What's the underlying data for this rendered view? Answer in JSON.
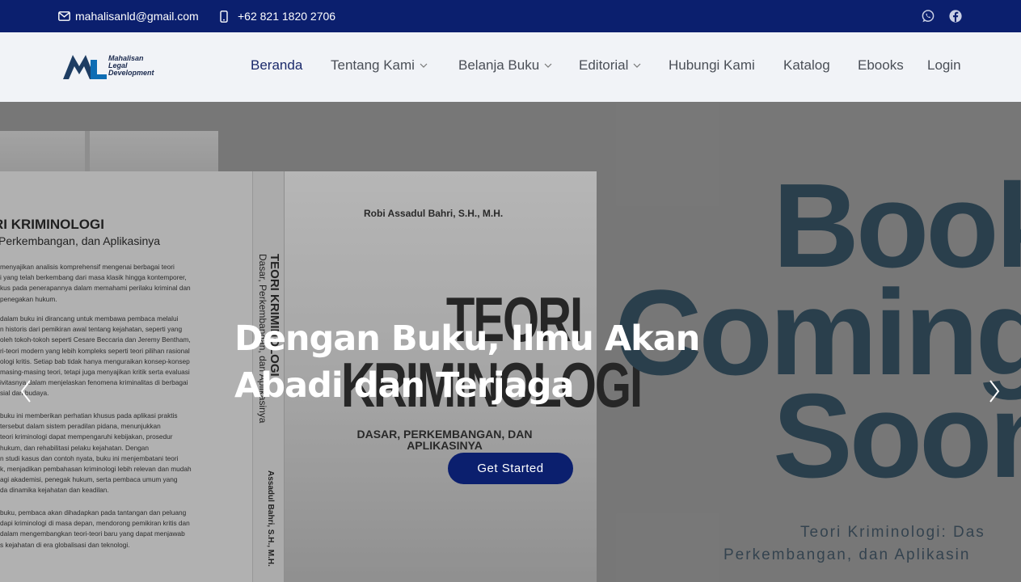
{
  "topbar": {
    "email": "mahalisanld@gmail.com",
    "phone": "+62 821 1820 2706",
    "icons": {
      "email": "envelope-icon",
      "phone": "phone-icon",
      "whatsapp": "whatsapp-icon",
      "facebook": "facebook-icon"
    }
  },
  "header": {
    "logo": {
      "line1": "Mahalisan",
      "line2": "Legal",
      "line3": "Development"
    },
    "nav": [
      {
        "label": "Beranda",
        "active": true
      },
      {
        "label": "Tentang Kami",
        "dropdown": true
      },
      {
        "label": "Belanja Buku",
        "dropdown": true
      },
      {
        "label": "Editorial",
        "dropdown": true
      },
      {
        "label": "Hubungi Kami"
      },
      {
        "label": "Katalog"
      },
      {
        "label": "Ebooks"
      },
      {
        "label": "Login"
      }
    ]
  },
  "hero": {
    "heading_line1": "Dengan Buku, Ilmu Akan",
    "heading_line2": "Abadi dan Terjaga",
    "cta_label": "Get Started",
    "book": {
      "author": "Robi Assadul Bahri, S.H., M.H.",
      "title_line1": "TEORI",
      "title_line2": "KRIMINOLOGI",
      "subtitle_line1": "DASAR, PERKEMBANGAN, DAN",
      "subtitle_line2": "APLIKASINYA",
      "back_title": "RI KRIMINOLOGI",
      "back_subtitle": "Perkembangan, dan Aplikasinya",
      "back_paragraphs": [
        [
          "menyajikan analisis komprehensif mengenai berbagai teori",
          "i yang telah berkembang dari masa klasik hingga kontemporer,",
          "kus pada penerapannya dalam memahami perilaku kriminal dan",
          "penegakan hukum."
        ],
        [
          "dalam buku ini dirancang untuk membawa pembaca melalui",
          "n historis dari pemikiran awal tentang kejahatan, seperti yang",
          "oleh tokoh-tokoh seperti Cesare Beccaria dan Jeremy Bentham,",
          "ri-teori modern yang lebih kompleks seperti teori pilihan rasional",
          "ologi kritis. Setiap bab tidak hanya menguraikan konsep-konsep",
          "masing-masing teori, tetapi juga menyajikan kritik serta evaluasi",
          "ivitasnya dalam menjelaskan fenomena kriminalitas di berbagai",
          "sial dan budaya."
        ],
        [
          "buku ini memberikan perhatian khusus pada aplikasi praktis",
          "tersebut dalam sistem peradilan pidana, menunjukkan",
          "teori kriminologi dapat mempengaruhi kebijakan, prosedur",
          "hukum, dan rehabilitasi pelaku kejahatan. Dengan",
          "n studi kasus dan contoh nyata, buku ini menjembatani teori",
          "k, menjadikan pembahasan kriminologi lebih relevan dan mudah",
          "agi akademisi, penegak hukum, serta pembaca umum yang",
          "da dinamika kejahatan dan keadilan."
        ],
        [
          "buku, pembaca akan dihadapkan pada tantangan dan peluang",
          "dapi kriminologi di masa depan, mendorong pemikiran kritis dan",
          "dalam mengembangkan teori-teori baru yang dapat menjawab",
          "s kejahatan di era globalisasi dan teknologi."
        ]
      ],
      "spine_title": "TEORI KRIMINOLOGI",
      "spine_subtitle": "Dasar, Perkembangan, dan Aplikasinya",
      "spine_author": "Assadul Bahri, S.H., M.H.",
      "coming_word1": "Book",
      "coming_word2": "Coming",
      "coming_word3": "Soon",
      "coming_caption1": "Teori Kriminologi: Das",
      "coming_caption2": "Perkembangan, dan Aplikasin"
    },
    "icons": {
      "prev": "chevron-left-icon",
      "next": "chevron-right-icon"
    }
  },
  "colors": {
    "primary": "#0b1f6e",
    "header_bg": "#f1f3f7",
    "nav_text": "#4a4f57",
    "nav_active": "#1b2a6b"
  }
}
